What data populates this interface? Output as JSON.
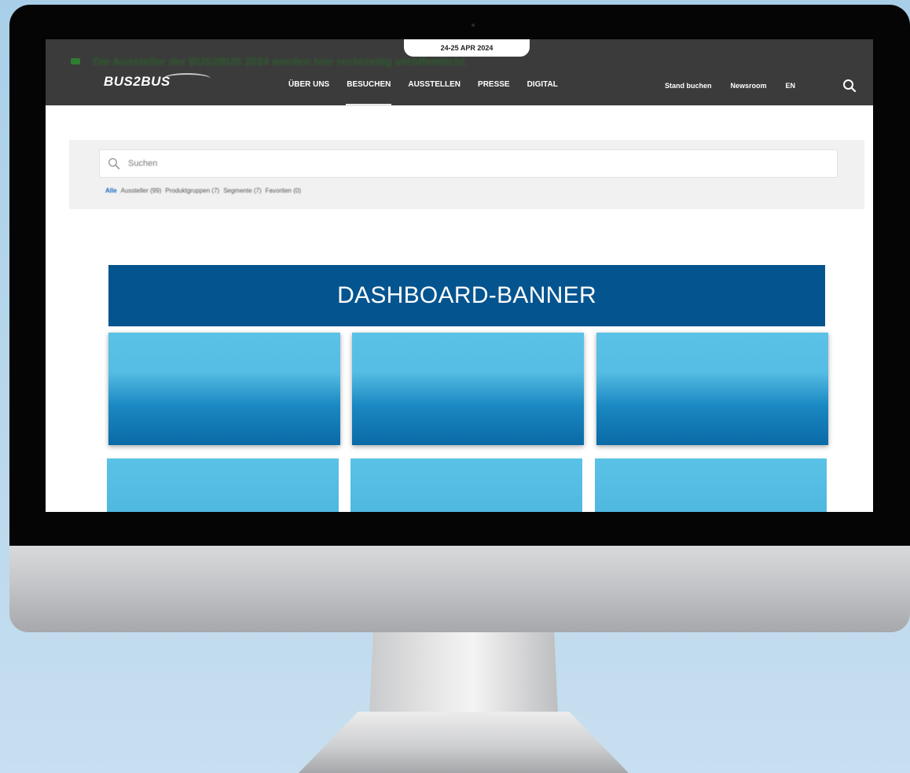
{
  "header": {
    "notice": "Die Aussteller der BUS2BUS 2024 werden hier rechtzeitig veröffentlicht.",
    "date_badge": "24-25 APR 2024",
    "logo_text": "BUS2BUS",
    "nav": [
      {
        "label": "ÜBER UNS",
        "active": false
      },
      {
        "label": "BESUCHEN",
        "active": true
      },
      {
        "label": "AUSSTELLEN",
        "active": false
      },
      {
        "label": "PRESSE",
        "active": false
      },
      {
        "label": "DIGITAL",
        "active": false
      }
    ],
    "right_links": [
      "Stand buchen",
      "Newsroom",
      "EN"
    ]
  },
  "search": {
    "placeholder": "Suchen",
    "filters": [
      {
        "label": "Alle",
        "active": true
      },
      {
        "label": "Aussteller (99)",
        "active": false
      },
      {
        "label": "Produktgruppen (7)",
        "active": false
      },
      {
        "label": "Segmente (7)",
        "active": false
      },
      {
        "label": "Favoriten (0)",
        "active": false
      }
    ]
  },
  "dashboard": {
    "banner": "DASHBOARD-BANNER"
  },
  "colors": {
    "topbar": "#3b3b3b",
    "banner": "#04548f",
    "tile_light": "#5ac2e6",
    "tile_dark": "#0a6aa6"
  }
}
